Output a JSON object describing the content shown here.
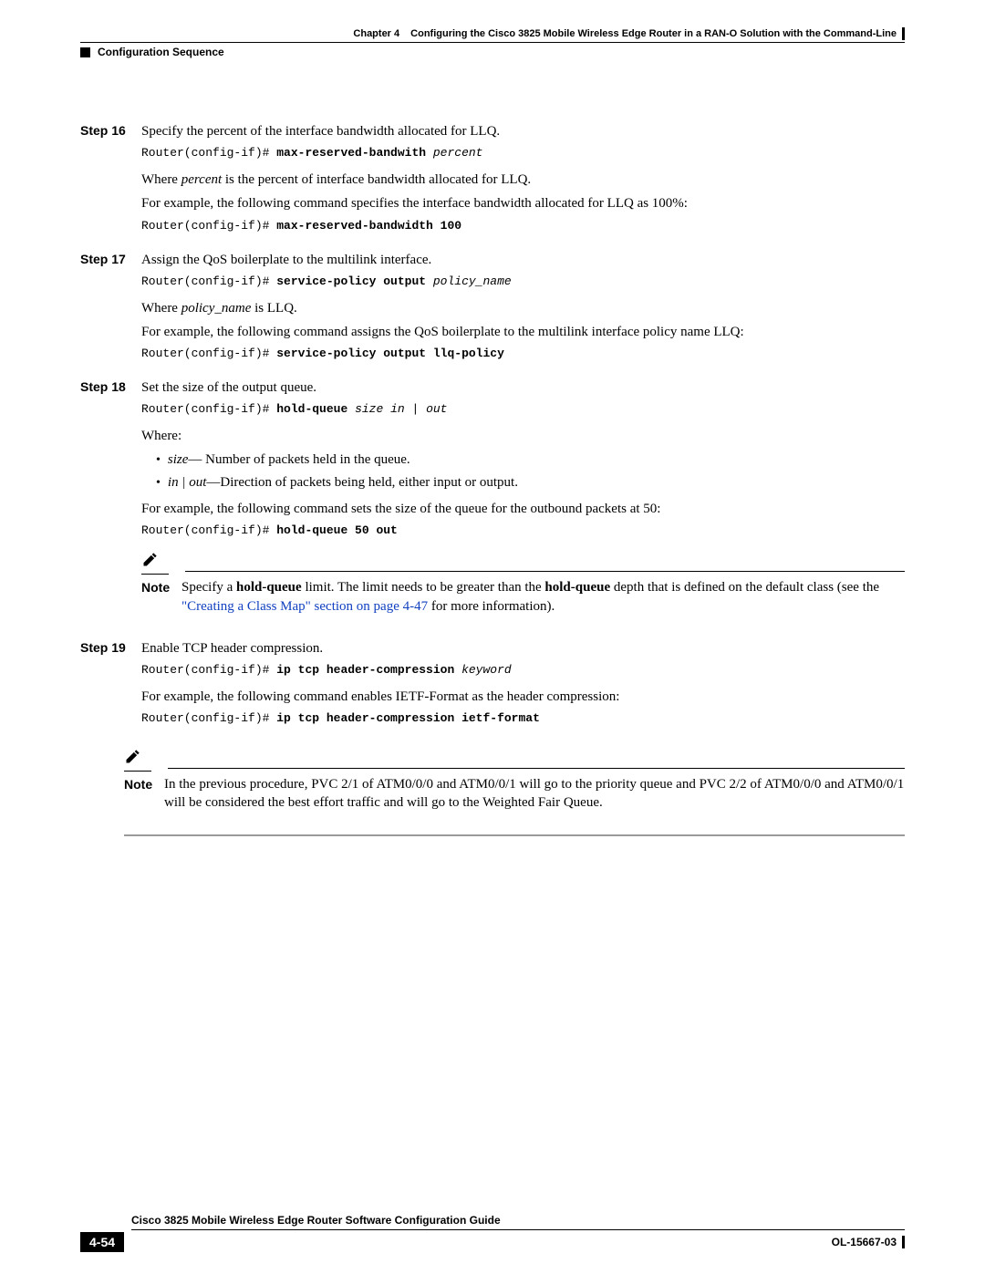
{
  "header": {
    "chapter": "Chapter 4",
    "chapter_title": "Configuring the Cisco 3825 Mobile Wireless Edge Router in a RAN-O Solution with the Command-Line",
    "section": "Configuration Sequence"
  },
  "steps": {
    "s16": {
      "label": "Step 16",
      "intro": "Specify the percent of the interface bandwidth allocated for LLQ.",
      "cmd1_prompt": "Router(config-if)# ",
      "cmd1_bold": "max-reserved-bandwith ",
      "cmd1_arg": "percent",
      "where_prefix": "Where ",
      "where_arg": "percent",
      "where_suffix": " is the percent of interface bandwidth allocated for LLQ.",
      "example_text": "For example, the following command specifies the interface bandwidth allocated for LLQ as 100%:",
      "cmd2_prompt": "Router(config-if)# ",
      "cmd2_bold": "max-reserved-bandwidth 100"
    },
    "s17": {
      "label": "Step 17",
      "intro": "Assign the QoS boilerplate to the multilink interface.",
      "cmd1_prompt": "Router(config-if)# ",
      "cmd1_bold": "service-policy output ",
      "cmd1_arg": "policy_name",
      "where_prefix": "Where ",
      "where_arg": "policy_name",
      "where_suffix": " is LLQ.",
      "example_text": "For example, the following command assigns the QoS boilerplate to the multilink interface policy name LLQ:",
      "cmd2_prompt": "Router(config-if)# ",
      "cmd2_bold": "service-policy output llq-policy"
    },
    "s18": {
      "label": "Step 18",
      "intro": "Set the size of the output queue.",
      "cmd1_prompt": "Router(config-if)# ",
      "cmd1_bold": "hold-queue ",
      "cmd1_arg": "size in | out",
      "where_label": "Where:",
      "bullet1_arg": "size",
      "bullet1_rest": "— Number of packets held in the queue.",
      "bullet2_arg": "in | out",
      "bullet2_rest": "—Direction of packets being held, either input or output.",
      "example_text": "For example, the following command sets the size of the queue for the outbound packets at 50:",
      "cmd2_prompt": "Router(config-if)# ",
      "cmd2_bold": "hold-queue 50 out",
      "note_label": "Note",
      "note_p1": "Specify a ",
      "note_b1": "hold-queue",
      "note_p2": " limit. The limit needs to be greater than the ",
      "note_b2": "hold-queue",
      "note_p3": " depth that is defined on the default class (see the ",
      "note_link": "\"Creating a Class Map\" section on page 4-47",
      "note_p4": " for more information)."
    },
    "s19": {
      "label": "Step 19",
      "intro": "Enable TCP header compression.",
      "cmd1_prompt": "Router(config-if)# ",
      "cmd1_bold": "ip tcp header-compression ",
      "cmd1_arg": "keyword",
      "example_text": "For example, the following command enables IETF-Format as the header compression:",
      "cmd2_prompt": "Router(config-if)# ",
      "cmd2_bold": "ip tcp header-compression ietf-format"
    }
  },
  "final_note": {
    "label": "Note",
    "text": "In the previous procedure, PVC 2/1 of ATM0/0/0 and ATM0/0/1 will go to the priority queue and PVC 2/2 of ATM0/0/0 and ATM0/0/1 will be considered the best effort traffic and will go to the Weighted Fair Queue."
  },
  "footer": {
    "guide_title": "Cisco 3825 Mobile Wireless Edge Router Software Configuration Guide",
    "page_num": "4-54",
    "doc_id": "OL-15667-03"
  }
}
